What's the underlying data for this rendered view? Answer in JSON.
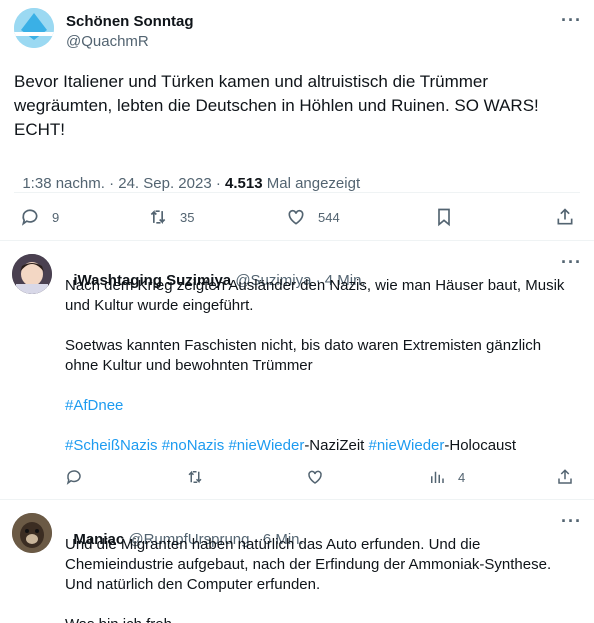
{
  "main_tweet": {
    "display_name": "Schönen Sonntag",
    "handle": "@QuachmR",
    "more": "···",
    "text_line1": "Bevor Italiener und Türken kamen und altruistisch die Trümmer",
    "text_line2": "wegräumten, lebten die Deutschen in Höhlen und Ruinen. SO WARS!",
    "text_line3": "ECHT!",
    "time": "1:38 nachm.",
    "sep1": " · ",
    "date": "24. Sep. 2023",
    "sep2": " · ",
    "views": "4.513",
    "views_label": " Mal angezeigt",
    "replies": "9",
    "retweets": "35",
    "likes": "544"
  },
  "reply1": {
    "display_name": "iWashtaging Suzimiya",
    "handle": "@Suzimiya",
    "time": " · 4 Min.",
    "more": "···",
    "p1_line1": "Nach dem Krieg zeigten Ausländer den Nazis, wie man  Häuser baut, Musik",
    "p1_line2": "und Kultur wurde eingeführt.",
    "p2_line1": "Soetwas kannten Faschisten nicht, bis dato waren Extremisten gänzlich",
    "p2_line2": "ohne Kultur und bewohnten Trümmer",
    "tag_afd": "#AfDnee",
    "tag1": "#ScheißNazis",
    "tag2": "#noNazis",
    "tag3": "#nieWieder",
    "plain1": "-NaziZeit ",
    "tag4": "#nieWieder",
    "plain2": "-Holocaust",
    "views": "4"
  },
  "reply2": {
    "display_name": "Maniac",
    "handle": "@RumpfUrsprung",
    "time": " · 6 Min.",
    "more": "···",
    "line1": "Und die Migranten haben natürlich das Auto erfunden. Und die",
    "line2": "Chemieindustrie aufgebaut, nach der Erfindung der Ammoniak-Synthese.",
    "line3": "Und natürlich den Computer erfunden.",
    "line4": "Was bin ich froh"
  }
}
